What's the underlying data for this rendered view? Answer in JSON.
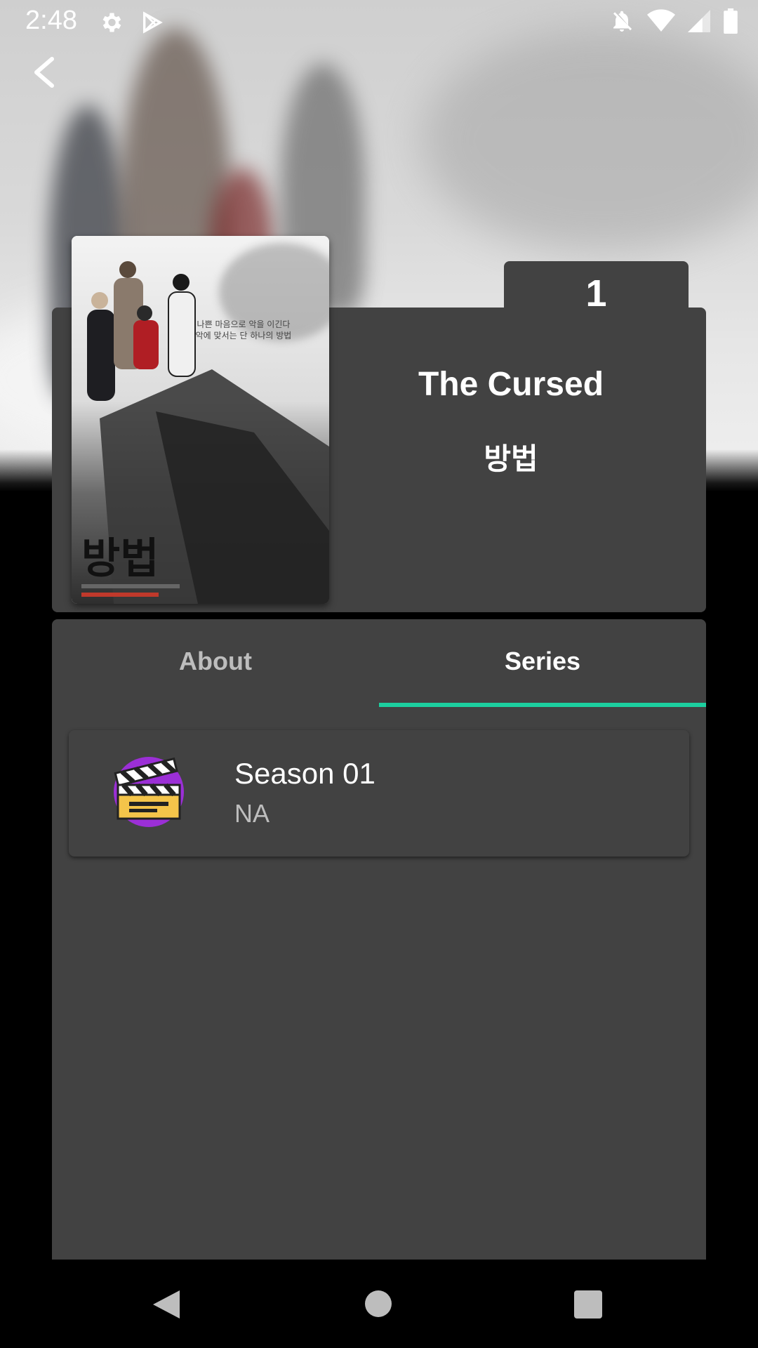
{
  "status_bar": {
    "time": "2:48",
    "icons": [
      "gear-icon",
      "play-store-icon",
      "notifications-off-icon",
      "wifi-icon",
      "signal-icon",
      "battery-icon"
    ]
  },
  "header": {
    "episode_count": "1",
    "title": "The Cursed",
    "title_original": "방법"
  },
  "tabs": [
    {
      "label": "About",
      "selected": false
    },
    {
      "label": "Series",
      "selected": true
    }
  ],
  "seasons": [
    {
      "title": "Season 01",
      "subtitle": "NA"
    }
  ],
  "colors": {
    "accent": "#1ccf9f",
    "card": "#424242",
    "background": "#000000"
  }
}
